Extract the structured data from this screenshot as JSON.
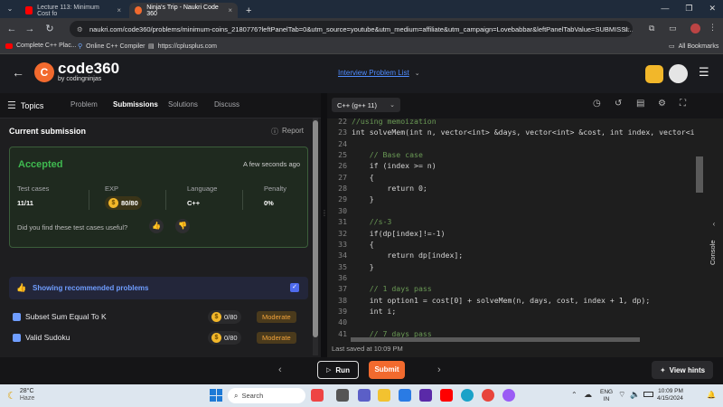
{
  "browser": {
    "tabs": [
      {
        "title": "Lecture 113: Minimum Cost fo",
        "close": "×"
      },
      {
        "title": "Ninja's Trip - Naukri Code 360",
        "close": "×"
      }
    ],
    "new_tab": "+",
    "url": "naukri.com/code360/problems/minimum-coins_2180776?leftPanelTab=0&utm_source=youtube&utm_medium=affiliate&utm_campaign=Lovebabbar&leftPanelTabValue=SUBMISSI...",
    "bookmarks": [
      "Complete C++ Plac...",
      "Online C++ Compiler",
      "https://cplusplus.com"
    ],
    "all_bookmarks": "All Bookmarks"
  },
  "header": {
    "logo_main": "code360",
    "logo_sub": "by codingninjas",
    "problem_list": "Interview Problem List"
  },
  "left": {
    "tabs": [
      "Topics",
      "Problem",
      "Submissions",
      "Solutions",
      "Discuss"
    ],
    "current_submission": "Current submission",
    "report": "Report",
    "status": "Accepted",
    "time": "A few seconds ago",
    "stats": [
      {
        "label": "Test cases",
        "value": "11/11"
      },
      {
        "label": "EXP",
        "value": "80/80"
      },
      {
        "label": "Language",
        "value": "C++"
      },
      {
        "label": "Penalty",
        "value": "0%"
      }
    ],
    "feedback": "Did you find these test cases useful?",
    "recommended": "Showing recommended problems",
    "problems": [
      {
        "name": "Subset Sum Equal To K",
        "exp": "0/80",
        "difficulty": "Moderate"
      },
      {
        "name": "Valid Sudoku",
        "exp": "0/80",
        "difficulty": "Moderate"
      }
    ]
  },
  "editor": {
    "language": "C++ (g++ 11)",
    "last_saved": "Last saved at 10:09 PM",
    "console": "Console"
  },
  "code": [
    {
      "n": "22",
      "text": "//using memoization"
    },
    {
      "n": "23",
      "text": "int solveMem(int n, vector<int> &days, vector<int> &cost, int index, vector<i"
    },
    {
      "n": "24",
      "text": ""
    },
    {
      "n": "25",
      "text": "    // Base case"
    },
    {
      "n": "26",
      "text": "    if (index >= n)"
    },
    {
      "n": "27",
      "text": "    {"
    },
    {
      "n": "28",
      "text": "        return 0;"
    },
    {
      "n": "29",
      "text": "    }"
    },
    {
      "n": "30",
      "text": ""
    },
    {
      "n": "31",
      "text": "    //s-3"
    },
    {
      "n": "32",
      "text": "    if(dp[index]!=-1)"
    },
    {
      "n": "33",
      "text": "    {"
    },
    {
      "n": "34",
      "text": "        return dp[index];"
    },
    {
      "n": "35",
      "text": "    }"
    },
    {
      "n": "36",
      "text": ""
    },
    {
      "n": "37",
      "text": "    // 1 days pass"
    },
    {
      "n": "38",
      "text": "    int option1 = cost[0] + solveMem(n, days, cost, index + 1, dp);"
    },
    {
      "n": "39",
      "text": "    int i;"
    },
    {
      "n": "40",
      "text": ""
    },
    {
      "n": "41",
      "text": "    // 7 days pass"
    }
  ],
  "bottom": {
    "run": "Run",
    "submit": "Submit",
    "view_hints": "View hints"
  },
  "taskbar": {
    "weather_temp": "28°C",
    "weather_text": "Haze",
    "search": "Search",
    "lang": "ENG",
    "region": "IN",
    "time": "10:09 PM",
    "date": "4/15/2024"
  },
  "colors": {
    "accent_orange": "#f26a2e",
    "accepted_green": "#3fb950",
    "link_blue": "#4f8cff"
  }
}
